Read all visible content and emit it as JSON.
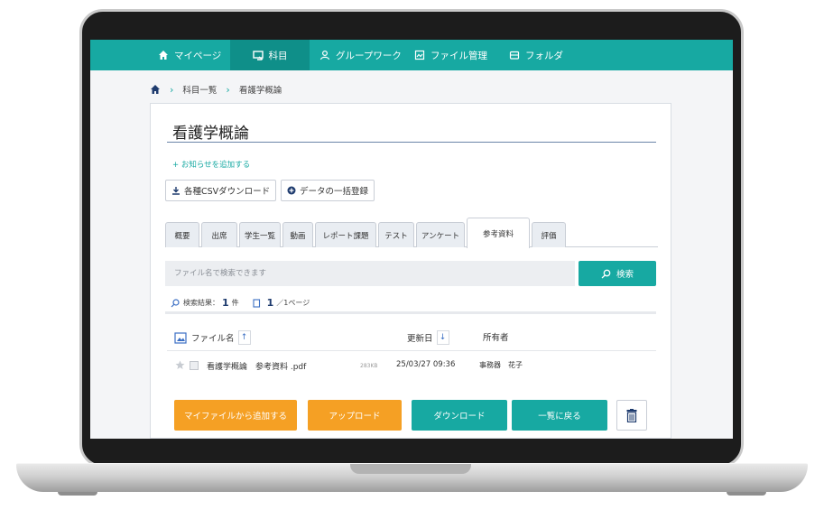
{
  "nav": {
    "items": [
      {
        "label": "マイページ",
        "icon": "home-icon"
      },
      {
        "label": "科目",
        "icon": "subject-icon",
        "active": true
      },
      {
        "label": "グループワーク",
        "icon": "group-icon"
      },
      {
        "label": "ファイル管理",
        "icon": "file-manage-icon"
      },
      {
        "label": "フォルダ",
        "icon": "folder-icon"
      }
    ],
    "accent": "#17a9a2"
  },
  "breadcrumb": {
    "home_icon": "home-icon",
    "items": [
      "科目一覧",
      "看護学概論"
    ]
  },
  "page": {
    "title": "看護学概論",
    "add_notice": "+ お知らせを追加する",
    "csv_button": "各種CSVダウンロード",
    "bulk_button": "データの一括登録"
  },
  "tabs": [
    {
      "label": "概要"
    },
    {
      "label": "出席"
    },
    {
      "label": "学生一覧"
    },
    {
      "label": "動画"
    },
    {
      "label": "レポート課題"
    },
    {
      "label": "テスト"
    },
    {
      "label": "アンケート"
    },
    {
      "label": "参考資料",
      "active": true
    },
    {
      "label": "評価"
    }
  ],
  "search": {
    "placeholder": "ファイル名で検索できます",
    "button": "検索"
  },
  "results": {
    "label": "検索結果：",
    "count": "1",
    "unit": "件",
    "page": "1",
    "page_suffix": "／1ページ"
  },
  "table": {
    "headers": {
      "name": "ファイル名",
      "updated": "更新日",
      "owner": "所有者"
    },
    "name_sort": "↑",
    "updated_sort": "↓",
    "rows": [
      {
        "name": "看護学概論　参考資料 .pdf",
        "size": "283KB",
        "updated": "25/03/27 09:36",
        "owner": "事務器　花子"
      }
    ]
  },
  "actions": {
    "add_from_my_files": "マイファイルから追加する",
    "upload": "アップロード",
    "download": "ダウンロード",
    "back_to_list": "一覧に戻る",
    "orange": "#f5a024"
  }
}
